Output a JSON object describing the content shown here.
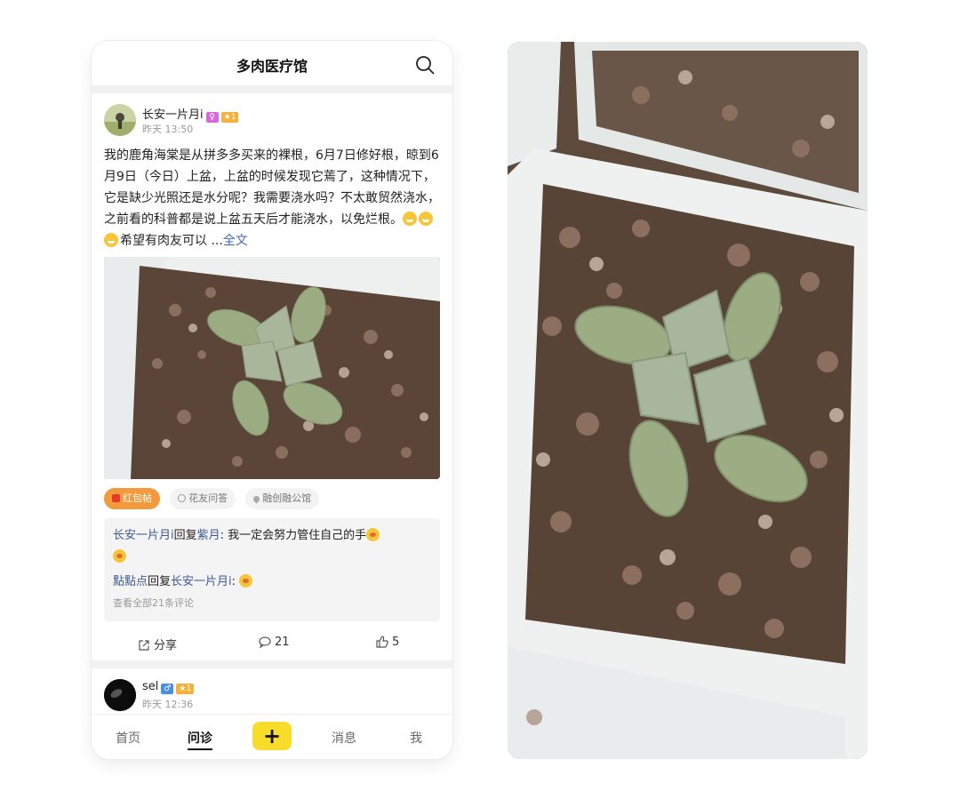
{
  "header": {
    "title": "多肉医疗馆",
    "search_icon": "search-icon"
  },
  "post": {
    "username": "长安一片月i",
    "badge_level": "★1",
    "time": "昨天 13:50",
    "text": "我的鹿角海棠是从拼多多买来的裸根，6月7日修好根，晾到6月9日（今日）上盆，上盆的时候发现它蔫了，这种情况下，它是缺少光照还是水分呢？我需要浇水吗？不太敢贸然浇水，之前看的科普都是说上盆五天后才能浇水，以免烂根。",
    "text_tail": "希望有肉友可以 ...",
    "more_label": "全文",
    "tags": [
      "红包帖",
      "花友问答",
      "融创融公馆"
    ],
    "comments": [
      {
        "author": "长安一片月i",
        "verb": "回复",
        "target": "紫月",
        "text": ": 我一定会努力管住自己的手"
      },
      {
        "author": "點點点",
        "verb": "回复",
        "target": "长安一片月i",
        "text": ":"
      }
    ],
    "view_all_comments": "查看全部21条评论",
    "actions": {
      "share": "分享",
      "comments": "21",
      "likes": "5"
    }
  },
  "post2": {
    "username": "sel",
    "gender": "♂",
    "badge_level": "★1",
    "time": "昨天 12:36"
  },
  "tabbar": {
    "home": "首页",
    "consult": "问诊",
    "plus": "+",
    "messages": "消息",
    "me": "我"
  },
  "colors": {
    "accent_yellow": "#f7dc2a",
    "link_blue": "#3e5a94",
    "tag_orange": "#f39a3d"
  }
}
